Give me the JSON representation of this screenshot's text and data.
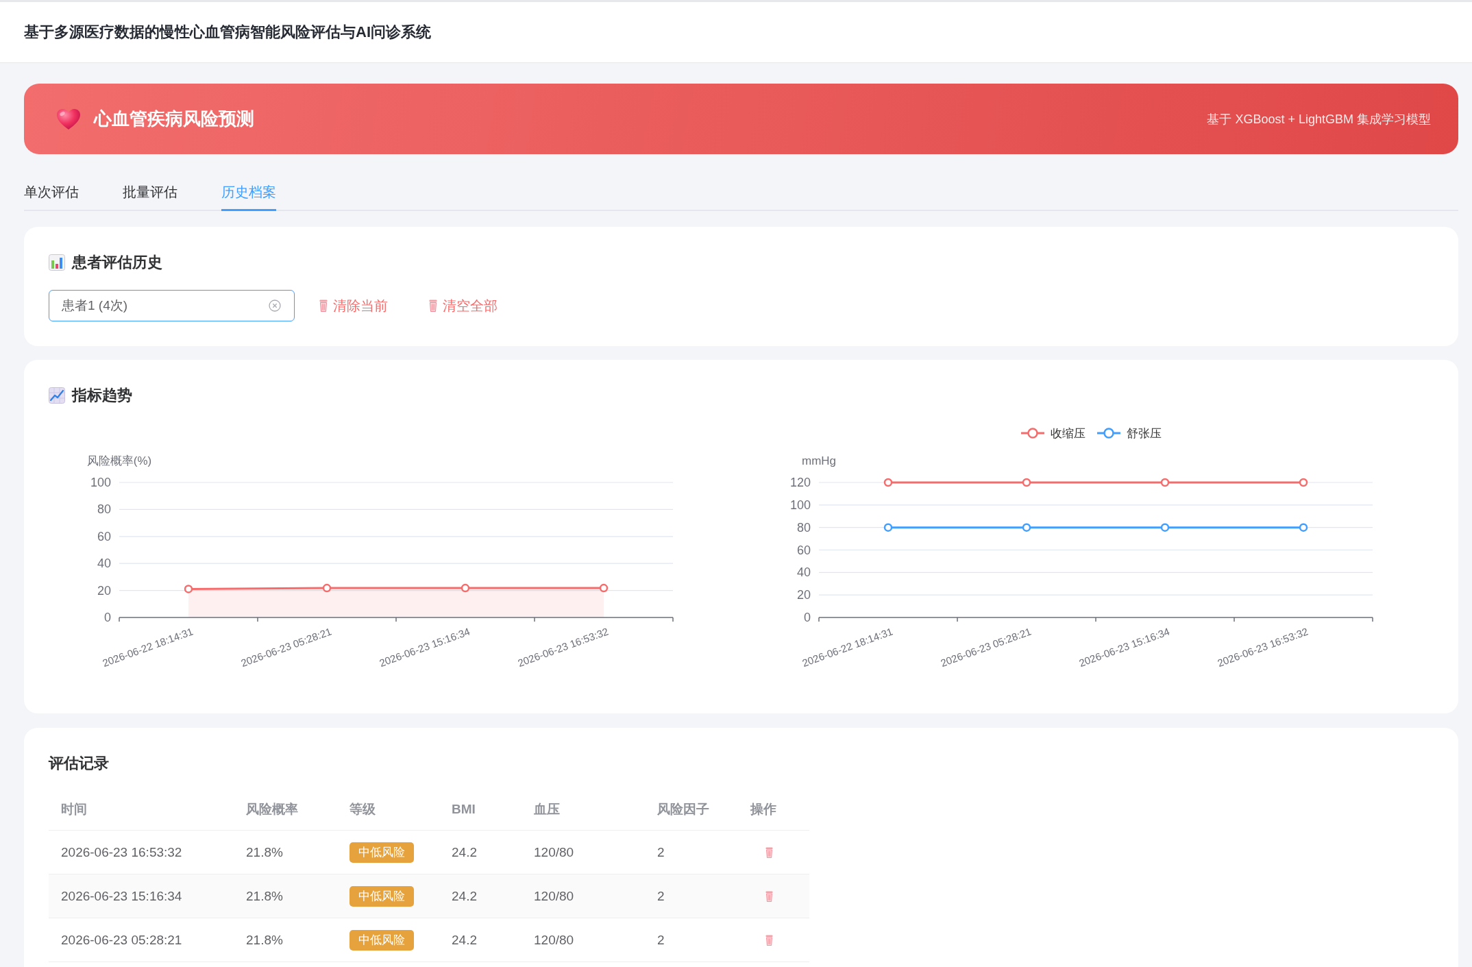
{
  "header": {
    "title": "基于多源医疗数据的慢性心血管病智能风险评估与AI问诊系统"
  },
  "banner": {
    "title": "心血管疾病风险预测",
    "subtitle": "基于 XGBoost + LightGBM 集成学习模型"
  },
  "tabs": [
    {
      "label": "单次评估",
      "selected": false
    },
    {
      "label": "批量评估",
      "selected": false
    },
    {
      "label": "历史档案",
      "selected": true
    }
  ],
  "history": {
    "title": "患者评估历史",
    "patient_select": {
      "value": "患者1 (4次)",
      "focused": true
    },
    "actions": [
      {
        "label": "清除当前"
      },
      {
        "label": "清空全部"
      }
    ]
  },
  "trend": {
    "title": "指标趋势",
    "charts": [
      {
        "chart_data": {
          "type": "area",
          "ylabel": "风险概率(%)",
          "categories": [
            "2026-06-22 18:14:31",
            "2026-06-23 05:28:21",
            "2026-06-23 15:16:34",
            "2026-06-23 16:53:32"
          ],
          "series": [
            {
              "color": "#f56c6c",
              "marker": "circle",
              "values": [
                21.1,
                21.8,
                21.8,
                21.8
              ]
            }
          ],
          "ylim": [
            0,
            100
          ],
          "yticks": [
            0,
            20,
            40,
            60,
            80,
            100
          ],
          "grid": true
        }
      },
      {
        "chart_data": {
          "type": "line",
          "ylabel": "mmHg",
          "categories": [
            "2026-06-22 18:14:31",
            "2026-06-23 05:28:21",
            "2026-06-23 15:16:34",
            "2026-06-23 16:53:32"
          ],
          "series": [
            {
              "name": "收缩压",
              "color": "#f56c6c",
              "marker": "circle",
              "values": [
                120,
                120,
                120,
                120
              ]
            },
            {
              "name": "舒张压",
              "color": "#409eff",
              "marker": "circle",
              "values": [
                80,
                80,
                80,
                80
              ]
            }
          ],
          "ylim": [
            0,
            120
          ],
          "yticks": [
            0,
            20,
            40,
            60,
            80,
            100,
            120
          ],
          "grid": true,
          "legend": "top"
        }
      }
    ]
  },
  "records": {
    "title": "评估记录",
    "columns": [
      "时间",
      "风险概率",
      "等级",
      "BMI",
      "血压",
      "风险因子",
      "操作"
    ],
    "rows": [
      {
        "time": "2026-06-23 16:53:32",
        "probability": "21.8%",
        "level": "中低风险",
        "bmi": "24.2",
        "blood_pressure": "120/80",
        "risk_factors": "2"
      },
      {
        "time": "2026-06-23 15:16:34",
        "probability": "21.8%",
        "level": "中低风险",
        "bmi": "24.2",
        "blood_pressure": "120/80",
        "risk_factors": "2"
      },
      {
        "time": "2026-06-23 05:28:21",
        "probability": "21.8%",
        "level": "中低风险",
        "bmi": "24.2",
        "blood_pressure": "120/80",
        "risk_factors": "2"
      }
    ]
  }
}
